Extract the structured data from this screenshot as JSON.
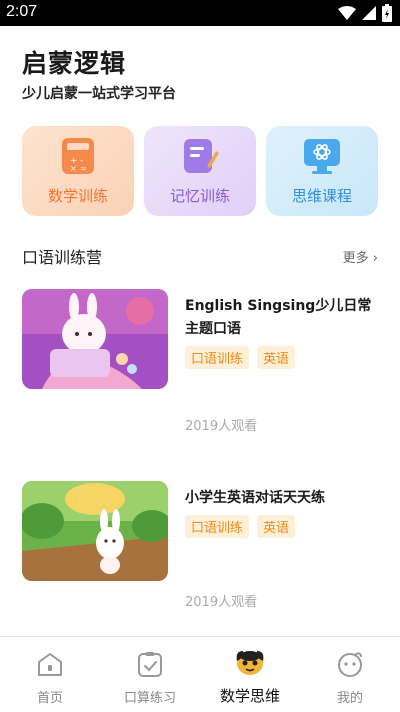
{
  "status_bar": {
    "time": "2:07"
  },
  "header": {
    "title": "启蒙逻辑",
    "subtitle": "少儿启蒙一站式学习平台"
  },
  "categories": [
    {
      "label": "数学训练",
      "icon": "calculator-icon",
      "color": "#f07632"
    },
    {
      "label": "记忆训练",
      "icon": "notepad-pencil-icon",
      "color": "#8a5cd6"
    },
    {
      "label": "思维课程",
      "icon": "monitor-atom-icon",
      "color": "#2e8fdb"
    }
  ],
  "section": {
    "title": "口语训练营",
    "more": "更多"
  },
  "courses": [
    {
      "title": "English Singsing少儿日常主题口语",
      "tags": [
        "口语训练",
        "英语"
      ],
      "views": "2019人观看"
    },
    {
      "title": "小学生英语对话天天练",
      "tags": [
        "口语训练",
        "英语"
      ],
      "views": "2019人观看"
    }
  ],
  "bottom_nav": [
    {
      "label": "首页",
      "icon": "home-icon",
      "active": false
    },
    {
      "label": "口算练习",
      "icon": "checklist-icon",
      "active": false
    },
    {
      "label": "数学思维",
      "icon": "mascot-icon",
      "active": true
    },
    {
      "label": "我的",
      "icon": "face-icon",
      "active": false
    }
  ],
  "colors": {
    "accent": "#f08a16",
    "tag_bg": "#fdf0d8"
  }
}
